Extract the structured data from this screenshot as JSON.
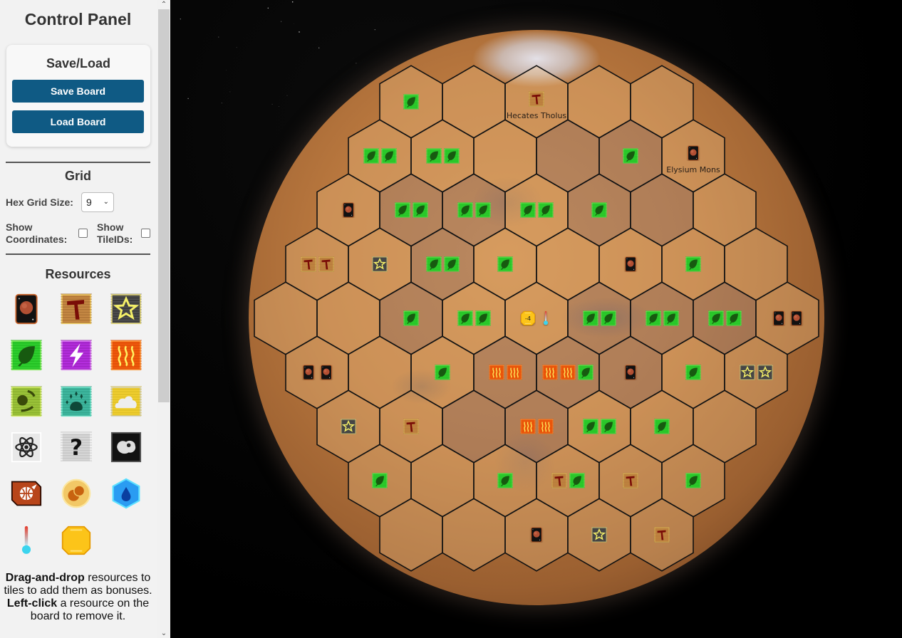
{
  "sidebar": {
    "title": "Control Panel",
    "save_load": {
      "heading": "Save/Load",
      "save_label": "Save Board",
      "load_label": "Load Board"
    },
    "grid": {
      "heading": "Grid",
      "size_label": "Hex Grid Size:",
      "size_value": "9",
      "show_coordinates_label_1": "Show",
      "show_coordinates_label_2": "Coordinates:",
      "show_coordinates_checked": false,
      "show_tileids_label_1": "Show",
      "show_tileids_label_2": "TileIDs:",
      "show_tileids_checked": false
    },
    "resources": {
      "heading": "Resources",
      "items": [
        {
          "id": "card",
          "name": "Card"
        },
        {
          "id": "steel",
          "name": "Steel"
        },
        {
          "id": "titanium",
          "name": "Titanium"
        },
        {
          "id": "plant",
          "name": "Plant"
        },
        {
          "id": "energy",
          "name": "Energy"
        },
        {
          "id": "heat",
          "name": "Heat"
        },
        {
          "id": "microbe",
          "name": "Microbe"
        },
        {
          "id": "animal",
          "name": "Animal"
        },
        {
          "id": "floater",
          "name": "Floater"
        },
        {
          "id": "science",
          "name": "Science"
        },
        {
          "id": "wild",
          "name": "Wild"
        },
        {
          "id": "asteroid",
          "name": "Asteroid"
        },
        {
          "id": "city-special",
          "name": "Special Tile"
        },
        {
          "id": "colony",
          "name": "Colony"
        },
        {
          "id": "ocean",
          "name": "Ocean"
        },
        {
          "id": "temperature",
          "name": "Temperature"
        },
        {
          "id": "megacredit",
          "name": "MegaCredit"
        }
      ]
    },
    "help": {
      "line1_bold": "Drag-and-drop",
      "line1_rest": " resources to tiles to add them as bonuses.",
      "line2_bold": "Left-click",
      "line2_rest": " a resource on the board to remove it."
    }
  },
  "board": {
    "hex_grid_size": 9,
    "rows": [
      [
        [
          "plant"
        ],
        [],
        [
          "steel"
        ],
        [],
        []
      ],
      [
        [
          "plant",
          "plant"
        ],
        [
          "plant",
          "plant"
        ],
        [],
        [],
        [
          "plant"
        ],
        [
          "card"
        ]
      ],
      [
        [
          "card"
        ],
        [
          "plant",
          "plant"
        ],
        [
          "plant",
          "plant"
        ],
        [
          "plant",
          "plant"
        ],
        [
          "plant"
        ],
        [],
        []
      ],
      [
        [
          "steel",
          "steel"
        ],
        [
          "titanium"
        ],
        [
          "plant",
          "plant"
        ],
        [
          "plant"
        ],
        [],
        [
          "card"
        ],
        [
          "plant"
        ],
        []
      ],
      [
        [],
        [],
        [
          "plant"
        ],
        [
          "plant",
          "plant"
        ],
        [
          "megacredit:-4",
          "temperature"
        ],
        [
          "plant",
          "plant"
        ],
        [
          "plant",
          "plant"
        ],
        [
          "plant",
          "plant"
        ],
        [
          "card",
          "card"
        ]
      ],
      [
        [
          "card",
          "card"
        ],
        [],
        [
          "plant"
        ],
        [
          "heat",
          "heat"
        ],
        [
          "heat",
          "heat",
          "plant"
        ],
        [
          "card"
        ],
        [
          "plant"
        ],
        [
          "titanium",
          "titanium"
        ]
      ],
      [
        [
          "titanium"
        ],
        [
          "steel"
        ],
        [],
        [
          "heat",
          "heat"
        ],
        [
          "plant",
          "plant"
        ],
        [
          "plant"
        ],
        []
      ],
      [
        [
          "plant"
        ],
        [],
        [
          "plant"
        ],
        [
          "steel",
          "plant"
        ],
        [
          "steel"
        ],
        [
          "plant"
        ]
      ],
      [
        [],
        [],
        [
          "card"
        ],
        [
          "titanium"
        ],
        [
          "steel"
        ]
      ]
    ],
    "darker_tiles": [
      "2-1",
      "2-2",
      "3-2",
      "4-2",
      "4-5",
      "4-6",
      "4-7",
      "5-3",
      "5-4",
      "5-5",
      "6-2",
      "6-3",
      "1-3",
      "1-4",
      "2-4",
      "2-5"
    ],
    "labels": [
      {
        "row": 0,
        "col": 2,
        "text": "Hecates Tholus"
      },
      {
        "row": 1,
        "col": 5,
        "text": "Elysium Mons"
      }
    ]
  }
}
